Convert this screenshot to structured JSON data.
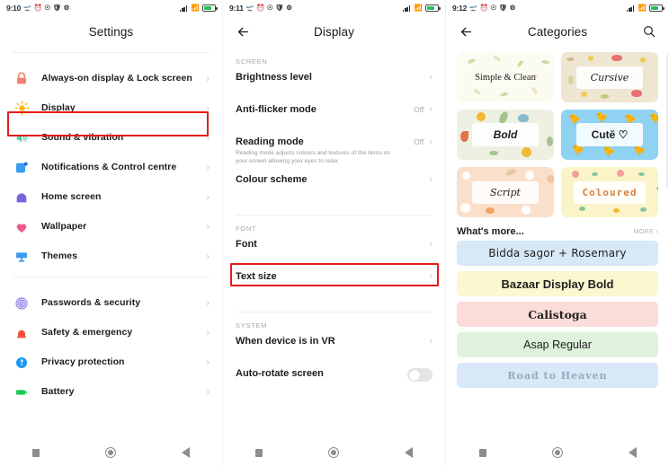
{
  "status_bar": {
    "times": [
      "9:10",
      "9:11",
      "9:12"
    ],
    "left_icons": [
      "airplane-icon",
      "alarm-icon",
      "dnd-icon",
      "shield-icon",
      "gear-icon"
    ],
    "right_icons": [
      "signal-icon",
      "wifi-icon",
      "battery-icon"
    ]
  },
  "panel1": {
    "title": "Settings",
    "items": [
      {
        "label": "Always-on display & Lock screen",
        "icon": "lock-icon",
        "color": "#f2836e",
        "chevron": "›"
      },
      {
        "label": "Display",
        "icon": "brightness-icon",
        "color": "#ffb61a",
        "chevron": "›"
      },
      {
        "label": "Sound & vibration",
        "icon": "speaker-icon",
        "color": "#3ecfa0",
        "chevron": "›"
      },
      {
        "label": "Notifications & Control centre",
        "icon": "notification-icon",
        "color": "#3c9bf0",
        "chevron": "›"
      },
      {
        "label": "Home screen",
        "icon": "home-icon",
        "color": "#7b63e0",
        "chevron": "›"
      },
      {
        "label": "Wallpaper",
        "icon": "wallpaper-icon",
        "color": "#f05b8f",
        "chevron": "›"
      },
      {
        "label": "Themes",
        "icon": "themes-icon",
        "color": "#3c9bf0",
        "chevron": "›"
      }
    ],
    "items2": [
      {
        "label": "Passwords & security",
        "icon": "fingerprint-icon",
        "color": "#8a7ae0",
        "chevron": "›"
      },
      {
        "label": "Safety & emergency",
        "icon": "siren-icon",
        "color": "#f2503c",
        "chevron": "›"
      },
      {
        "label": "Privacy protection",
        "icon": "privacy-icon",
        "color": "#1e97f0",
        "chevron": "›"
      },
      {
        "label": "Battery",
        "icon": "battery-icon",
        "color": "#1fc濾56",
        "chevron": "›"
      }
    ],
    "highlight": "Display"
  },
  "panel2": {
    "title": "Display",
    "back_icon": "back-arrow-icon",
    "sections": [
      {
        "header": "SCREEN",
        "rows": [
          {
            "label": "Brightness level",
            "desc": "",
            "value": "",
            "chevron": "›"
          },
          {
            "label": "Anti-flicker mode",
            "desc": "",
            "value": "Off",
            "chevron": "›"
          },
          {
            "label": "Reading mode",
            "desc": "Reading mode adjusts colours and textures of the items on your screen allowing your eyes to relax",
            "value": "Off",
            "chevron": "›"
          },
          {
            "label": "Colour scheme",
            "desc": "",
            "value": "",
            "chevron": "›"
          }
        ]
      },
      {
        "header": "FONT",
        "rows": [
          {
            "label": "Font",
            "desc": "",
            "value": "",
            "chevron": "›"
          },
          {
            "label": "Text size",
            "desc": "",
            "value": "",
            "chevron": "›"
          }
        ]
      },
      {
        "header": "SYSTEM",
        "rows": [
          {
            "label": "When device is in VR",
            "desc": "",
            "value": "",
            "chevron": "›"
          },
          {
            "label": "Auto-rotate screen",
            "desc": "",
            "value": "",
            "toggle": "off"
          }
        ]
      }
    ],
    "highlight": "Font"
  },
  "panel3": {
    "title": "Categories",
    "back_icon": "back-arrow-icon",
    "search_icon": "search-icon",
    "categories": [
      {
        "label": "Simple & Clean",
        "bg": "#fcfbf2",
        "style": "plain"
      },
      {
        "label": "Cursive",
        "bg": "#efe6d2",
        "style": "framed"
      },
      {
        "label": "Bold",
        "bg": "#eef0e2",
        "style": "framed"
      },
      {
        "label": "Cutĕ ♡",
        "bg": "#8fd2f2",
        "style": "framed"
      },
      {
        "label": "Script",
        "bg": "#fadfcb",
        "style": "framed"
      },
      {
        "label": "Coloured",
        "bg": "#fbf4c8",
        "style": "framed"
      }
    ],
    "whats_more": {
      "title": "What's more...",
      "more_label": "MORE",
      "more_chevron": "›"
    },
    "fonts": [
      {
        "name": "Bidda sagor + Rosemary",
        "bg": "#d7e8f7",
        "class": "f-bidda"
      },
      {
        "name": "Bazaar Display Bold",
        "bg": "#fbf7cf",
        "class": "f-bazaar"
      },
      {
        "name": "Calistoga",
        "bg": "#fbdcd8",
        "class": "f-calistoga"
      },
      {
        "name": "Asap Regular",
        "bg": "#dff2dc",
        "class": "f-asap"
      },
      {
        "name": "Road to Heaven",
        "bg": "#d8e8f8",
        "class": "f-road"
      }
    ]
  },
  "navbar": {
    "items": [
      "recents-button",
      "home-button",
      "back-button"
    ]
  },
  "colors": {
    "highlight": "#e81b1b",
    "accent": "#3c9bf0"
  }
}
